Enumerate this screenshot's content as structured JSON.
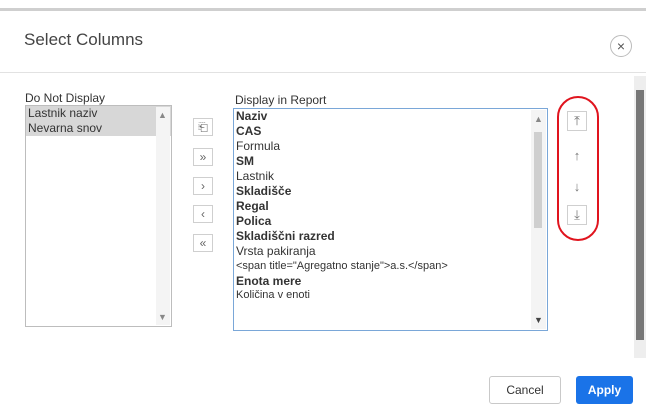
{
  "dialog": {
    "title": "Select Columns",
    "close_glyph": "×",
    "cancel_label": "Cancel",
    "apply_label": "Apply",
    "accent_color": "#1a73e8",
    "highlight_color": "#e0141e"
  },
  "do_not_display": {
    "label": "Do Not Display",
    "items": [
      "Lastnik naziv",
      "Nevarna snov"
    ]
  },
  "display_in_report": {
    "label": "Display in Report",
    "items": [
      "Naziv",
      "CAS",
      "Formula",
      "SM",
      "Lastnik",
      "Skladišče",
      "Regal",
      "Polica",
      "Skladiščni razred",
      "Vrsta pakiranja",
      "<span title=\"Agregatno stanje\">a.s.</span>",
      "Enota mere",
      "Količina v enoti"
    ]
  },
  "move_buttons": {
    "reset": {
      "icon": "reset-icon",
      "glyph": "⎗"
    },
    "move_all_right": {
      "icon": "double-chevron-right-icon",
      "glyph": "»"
    },
    "move_right": {
      "icon": "chevron-right-icon",
      "glyph": "›"
    },
    "move_left": {
      "icon": "chevron-left-icon",
      "glyph": "‹"
    },
    "move_all_left": {
      "icon": "double-chevron-left-icon",
      "glyph": "«"
    }
  },
  "order_buttons": {
    "top": {
      "icon": "move-top-icon",
      "glyph": "⤒"
    },
    "up": {
      "icon": "move-up-icon",
      "glyph": "↑"
    },
    "down": {
      "icon": "move-down-icon",
      "glyph": "↓"
    },
    "bottom": {
      "icon": "move-bottom-icon",
      "glyph": "⤓"
    }
  },
  "scroll": {
    "up_glyph": "▲",
    "down_glyph": "▼"
  }
}
